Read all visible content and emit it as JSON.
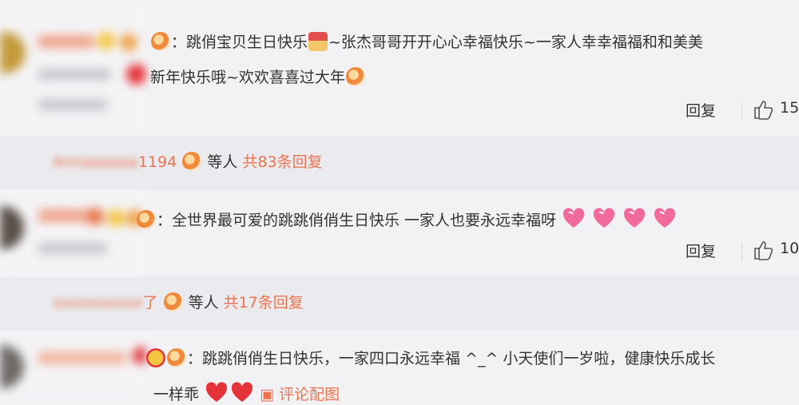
{
  "comments": [
    {
      "text_a": "：跳俏宝贝生日快乐",
      "text_b": "~张杰哥哥开开心心幸福快乐~一家人幸幸福福和和美美",
      "text_c": "新年快乐哦~欢欢喜喜过大年",
      "reply_label": "回复",
      "like_count": "15"
    },
    {
      "text_a": "：全世界最可爱的跳跳俏俏生日快乐 一家人也要永远幸福呀",
      "reply_label": "回复",
      "like_count": "10"
    },
    {
      "text_a": "：跳跳俏俏生日快乐，一家四口永远幸福 ^_^ 小天使们一岁啦，健康快乐成长",
      "text_b": "一样乖",
      "image_link": "评论配图"
    }
  ],
  "threads": [
    {
      "name_tail": "1194",
      "others": "等人",
      "count_text": "共83条回复"
    },
    {
      "name_tail": "了",
      "others": "等人",
      "count_text": "共17条回复"
    }
  ],
  "icons": {
    "emoji": "smile-emoji-icon",
    "gift": "gift-emoji-icon",
    "heart": "love-heart-icon",
    "like": "thumbs-up-icon"
  },
  "colors": {
    "accent": "#eb7350",
    "text": "#333333",
    "background": "#f2f2f5",
    "thread_background": "#ebebef"
  }
}
